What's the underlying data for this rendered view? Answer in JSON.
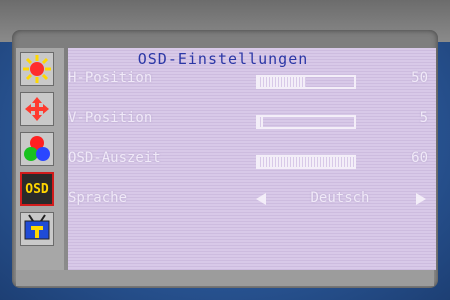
{
  "osd": {
    "title": "OSD-Einstellungen",
    "rows": [
      {
        "label": "H-Position",
        "value": "50",
        "level_percent": 50
      },
      {
        "label": "V-Position",
        "value": "5",
        "level_percent": 5
      },
      {
        "label": "OSD-Auszeit",
        "value": "60",
        "level_percent": 100
      }
    ],
    "language": {
      "label": "Sprache",
      "value": "Deutsch"
    }
  },
  "sidebar": {
    "icons": [
      {
        "name": "brightness-icon"
      },
      {
        "name": "position-icon"
      },
      {
        "name": "color-icon"
      },
      {
        "name": "osd-icon",
        "text": "OSD",
        "selected": true
      },
      {
        "name": "tv-tools-icon"
      }
    ]
  },
  "colors": {
    "panel": "#d8c9e8",
    "title": "#2b37a6",
    "text": "#f0e9f8",
    "selected_border": "#d21c1c",
    "osd_icon_text": "#ffd500"
  }
}
